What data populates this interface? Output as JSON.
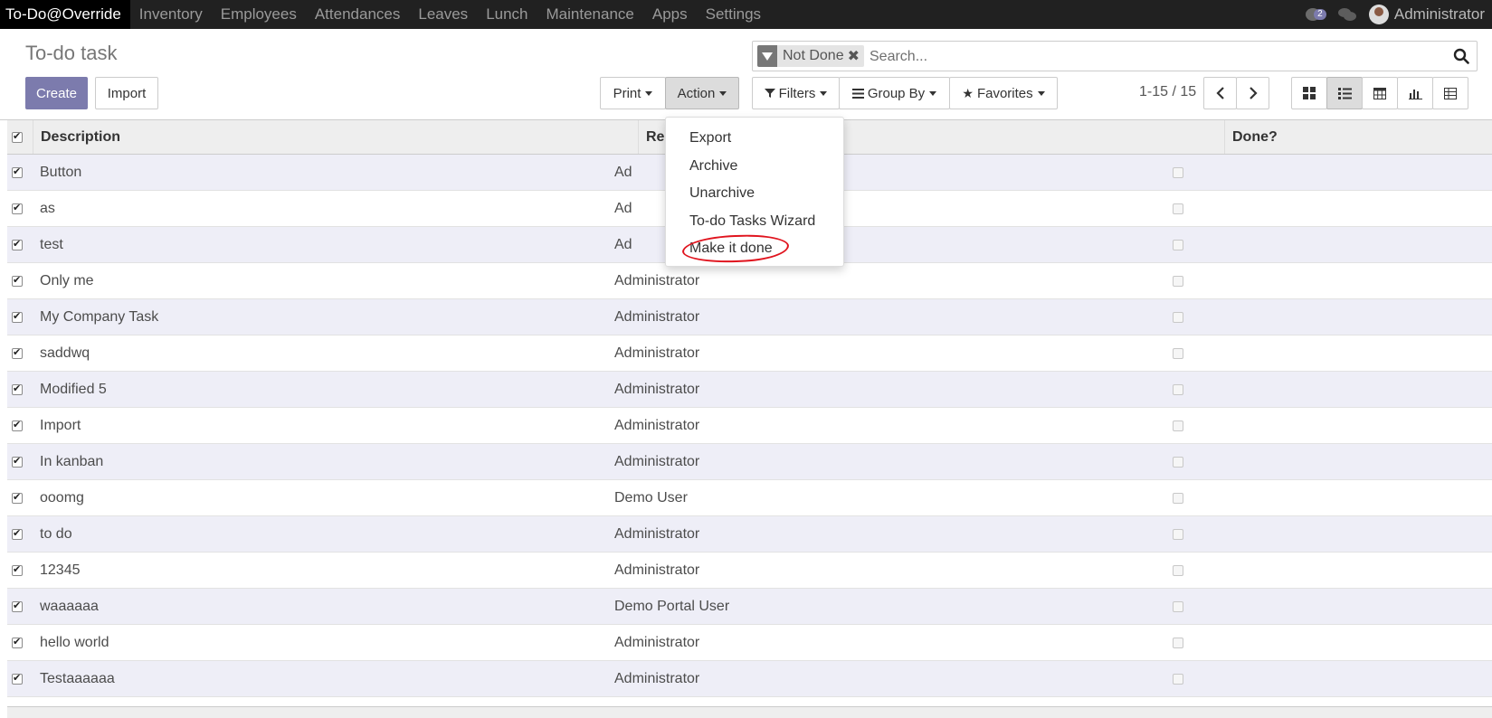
{
  "app": {
    "brand": "To-Do@Override",
    "menu": [
      "Inventory",
      "Employees",
      "Attendances",
      "Leaves",
      "Lunch",
      "Maintenance",
      "Apps",
      "Settings"
    ],
    "activity_count": "2",
    "user": "Administrator"
  },
  "control_panel": {
    "title": "To-do task",
    "create_label": "Create",
    "import_label": "Import",
    "print_label": "Print",
    "action_label": "Action",
    "filters_label": "Filters",
    "group_by_label": "Group By",
    "favorites_label": "Favorites",
    "search": {
      "facet": "Not Done",
      "placeholder": "Search..."
    },
    "pager": "1-15 / 15"
  },
  "action_menu": {
    "items": [
      "Export",
      "Archive",
      "Unarchive",
      "To-do Tasks Wizard",
      "Make it done"
    ]
  },
  "table": {
    "columns": {
      "description": "Description",
      "responsible": "Re",
      "done": "Done?"
    },
    "rows": [
      {
        "description": "Button",
        "responsible": "Ad"
      },
      {
        "description": "as",
        "responsible": "Ad"
      },
      {
        "description": "test",
        "responsible": "Ad"
      },
      {
        "description": "Only me",
        "responsible": "Administrator"
      },
      {
        "description": "My Company Task",
        "responsible": "Administrator"
      },
      {
        "description": "saddwq",
        "responsible": "Administrator"
      },
      {
        "description": "Modified 5",
        "responsible": "Administrator"
      },
      {
        "description": "Import",
        "responsible": "Administrator"
      },
      {
        "description": "In kanban",
        "responsible": "Administrator"
      },
      {
        "description": "ooomg",
        "responsible": "Demo User"
      },
      {
        "description": "to do",
        "responsible": "Administrator"
      },
      {
        "description": "12345",
        "responsible": "Administrator"
      },
      {
        "description": "waaaaaa",
        "responsible": "Demo Portal User"
      },
      {
        "description": "hello world",
        "responsible": "Administrator"
      },
      {
        "description": "Testaaaaaa",
        "responsible": "Administrator"
      }
    ]
  },
  "colors": {
    "primary": "#7c7bad",
    "navbar": "#212121",
    "row_alt": "#eeeef7",
    "annotation": "#e0141e"
  }
}
